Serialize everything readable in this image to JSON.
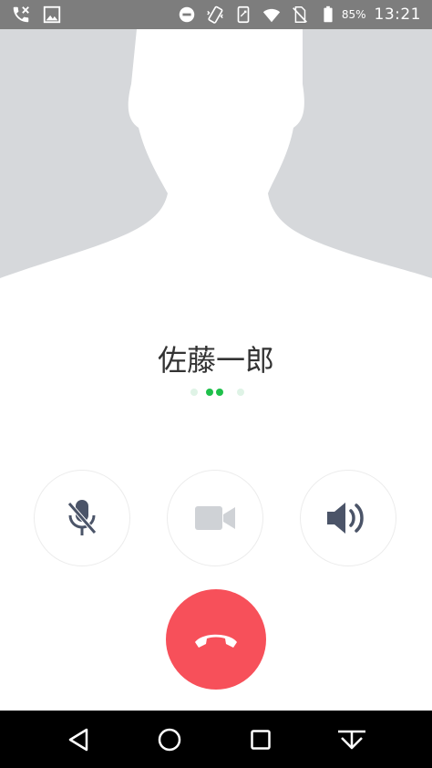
{
  "status_bar": {
    "icons_left": [
      "phone-missed-call-icon",
      "image-icon"
    ],
    "icons_right": [
      "do-not-disturb-icon",
      "vibrate-icon",
      "screen-rotate-icon",
      "wifi-icon",
      "no-sim-icon",
      "battery-icon"
    ],
    "battery_percent": "85%",
    "time": "13:21"
  },
  "caller": {
    "name": "佐藤一郎"
  },
  "call_status": {
    "dots": [
      "#dff3e6",
      "#1fc04b",
      "#1fc04b",
      "#dff3e6"
    ]
  },
  "controls": [
    {
      "name": "mute",
      "icon": "microphone-off-icon"
    },
    {
      "name": "video",
      "icon": "video-camera-icon"
    },
    {
      "name": "speaker",
      "icon": "speaker-icon"
    }
  ],
  "end_call": {
    "icon": "hang-up-icon",
    "color": "#f7505a"
  },
  "nav_bar": {
    "icons": [
      "back-icon",
      "home-icon",
      "recents-icon",
      "notification-pull-icon"
    ]
  },
  "colors": {
    "accent_green": "#1fc04b",
    "end_call_red": "#f7505a",
    "icon_gray": "#cfd2d6",
    "icon_dark": "#4b5468"
  }
}
